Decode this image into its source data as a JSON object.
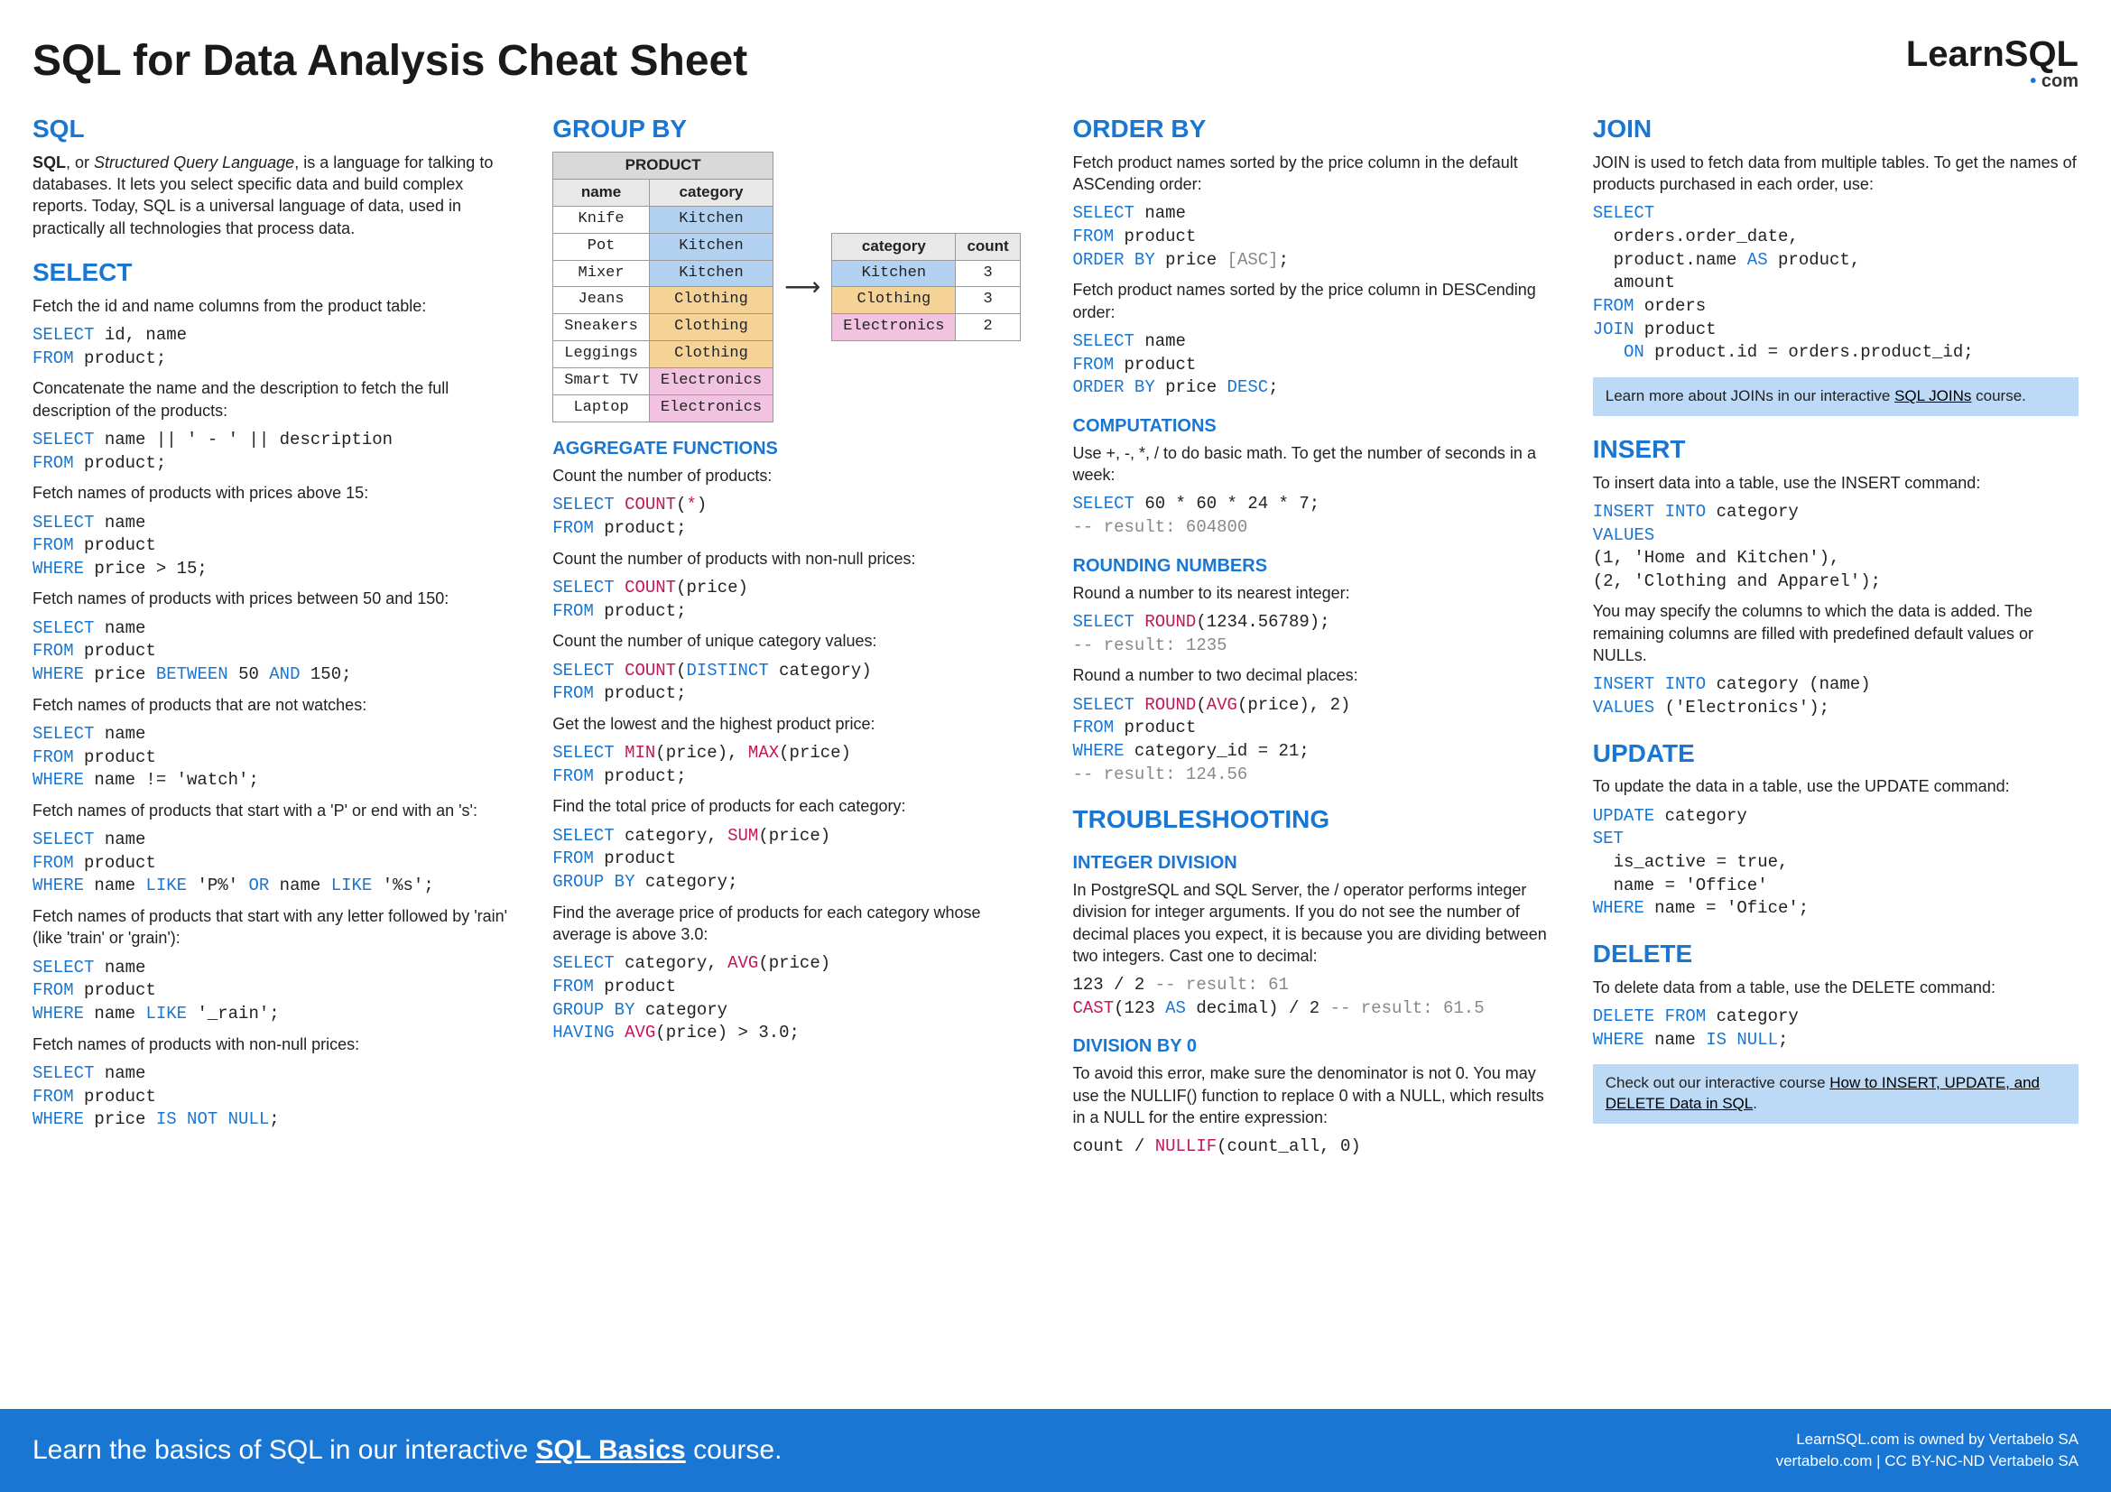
{
  "title": "SQL for Data Analysis Cheat Sheet",
  "logo": {
    "learn": "Learn",
    "sql": "SQL",
    "dot": "•",
    "com": "com"
  },
  "sql": {
    "heading": "SQL",
    "intro_pre": "SQL",
    "intro_mid": ", or ",
    "intro_em": "Structured Query Language",
    "intro_post": ", is a language for talking to databases. It lets you select specific data and build complex reports. Today, SQL is a universal language of data, used in practically all technologies that process data."
  },
  "select": {
    "heading": "SELECT",
    "ex1_desc": "Fetch the id and name columns from the product table:",
    "ex1_l1a": "SELECT",
    "ex1_l1b": " id, name",
    "ex1_l2a": "FROM",
    "ex1_l2b": " product;",
    "ex2_desc": "Concatenate the name and the description to fetch the full description of the products:",
    "ex2_l1a": "SELECT",
    "ex2_l1b": " name || ' - ' || description",
    "ex2_l2a": "FROM",
    "ex2_l2b": " product;",
    "ex3_desc": "Fetch names of products with prices above 15:",
    "ex3_l1a": "SELECT",
    "ex3_l1b": " name",
    "ex3_l2a": "FROM",
    "ex3_l2b": " product",
    "ex3_l3a": "WHERE",
    "ex3_l3b": " price > 15;",
    "ex4_desc": "Fetch names of products with prices between 50 and 150:",
    "ex4_l1a": "SELECT",
    "ex4_l1b": " name",
    "ex4_l2a": "FROM",
    "ex4_l2b": " product",
    "ex4_l3a": "WHERE",
    "ex4_l3b": " price ",
    "ex4_l3c": "BETWEEN",
    "ex4_l3d": " 50 ",
    "ex4_l3e": "AND",
    "ex4_l3f": " 150;",
    "ex5_desc": "Fetch names of products that are not watches:",
    "ex5_l1a": "SELECT",
    "ex5_l1b": " name",
    "ex5_l2a": "FROM",
    "ex5_l2b": " product",
    "ex5_l3a": "WHERE",
    "ex5_l3b": " name != 'watch';",
    "ex6_desc": "Fetch names of products that start with a 'P' or end with an 's':",
    "ex6_l1a": "SELECT",
    "ex6_l1b": " name",
    "ex6_l2a": "FROM",
    "ex6_l2b": " product",
    "ex6_l3a": "WHERE",
    "ex6_l3b": " name ",
    "ex6_l3c": "LIKE",
    "ex6_l3d": " 'P%' ",
    "ex6_l3e": "OR",
    "ex6_l3f": " name ",
    "ex6_l3g": "LIKE",
    "ex6_l3h": " '%s';",
    "ex7_desc": "Fetch names of products that start with any letter followed by 'rain' (like 'train' or 'grain'):",
    "ex7_l1a": "SELECT",
    "ex7_l1b": " name",
    "ex7_l2a": "FROM",
    "ex7_l2b": " product",
    "ex7_l3a": "WHERE",
    "ex7_l3b": " name ",
    "ex7_l3c": "LIKE",
    "ex7_l3d": " '_rain';",
    "ex8_desc": "Fetch names of products with non-null prices:",
    "ex8_l1a": "SELECT",
    "ex8_l1b": " name",
    "ex8_l2a": "FROM",
    "ex8_l2b": " product",
    "ex8_l3a": "WHERE",
    "ex8_l3b": " price ",
    "ex8_l3c": "IS NOT NULL",
    "ex8_l3d": ";"
  },
  "groupby": {
    "heading": "GROUP BY",
    "table_title": "PRODUCT",
    "h_name": "name",
    "h_category": "category",
    "h_count": "count",
    "rows": [
      {
        "name": "Knife",
        "cat": "Kitchen",
        "cls": "cat-kitchen"
      },
      {
        "name": "Pot",
        "cat": "Kitchen",
        "cls": "cat-kitchen"
      },
      {
        "name": "Mixer",
        "cat": "Kitchen",
        "cls": "cat-kitchen"
      },
      {
        "name": "Jeans",
        "cat": "Clothing",
        "cls": "cat-clothing"
      },
      {
        "name": "Sneakers",
        "cat": "Clothing",
        "cls": "cat-clothing"
      },
      {
        "name": "Leggings",
        "cat": "Clothing",
        "cls": "cat-clothing"
      },
      {
        "name": "Smart TV",
        "cat": "Electronics",
        "cls": "cat-electronics"
      },
      {
        "name": "Laptop",
        "cat": "Electronics",
        "cls": "cat-electronics"
      }
    ],
    "agg": [
      {
        "cat": "Kitchen",
        "count": "3",
        "cls": "cat-kitchen"
      },
      {
        "cat": "Clothing",
        "count": "3",
        "cls": "cat-clothing"
      },
      {
        "cat": "Electronics",
        "count": "2",
        "cls": "cat-electronics"
      }
    ],
    "arrow": "⟶"
  },
  "aggfn": {
    "heading": "AGGREGATE FUNCTIONS",
    "e1_desc": "Count the number of products:",
    "e1_l1a": "SELECT ",
    "e1_l1b": "COUNT",
    "e1_l1c": "(",
    "e1_l1d": "*",
    "e1_l1e": ")",
    "e1_l2a": "FROM",
    "e1_l2b": " product;",
    "e2_desc": "Count the number of products with non-null prices:",
    "e2_l1a": "SELECT ",
    "e2_l1b": "COUNT",
    "e2_l1c": "(price)",
    "e2_l2a": "FROM",
    "e2_l2b": " product;",
    "e3_desc": "Count the number of unique category values:",
    "e3_l1a": "SELECT ",
    "e3_l1b": "COUNT",
    "e3_l1c": "(",
    "e3_l1d": "DISTINCT",
    "e3_l1e": " category)",
    "e3_l2a": "FROM",
    "e3_l2b": " product;",
    "e4_desc": "Get the lowest and the highest product price:",
    "e4_l1a": "SELECT ",
    "e4_l1b": "MIN",
    "e4_l1c": "(price), ",
    "e4_l1d": "MAX",
    "e4_l1e": "(price)",
    "e4_l2a": "FROM",
    "e4_l2b": " product;",
    "e5_desc": "Find the total price of products for each category:",
    "e5_l1a": "SELECT",
    "e5_l1b": " category, ",
    "e5_l1c": "SUM",
    "e5_l1d": "(price)",
    "e5_l2a": "FROM",
    "e5_l2b": " product",
    "e5_l3a": "GROUP BY",
    "e5_l3b": " category;",
    "e6_desc": "Find the average price of products for each category whose average is above 3.0:",
    "e6_l1a": "SELECT",
    "e6_l1b": " category, ",
    "e6_l1c": "AVG",
    "e6_l1d": "(price)",
    "e6_l2a": "FROM",
    "e6_l2b": " product",
    "e6_l3a": "GROUP BY",
    "e6_l3b": " category",
    "e6_l4a": "HAVING ",
    "e6_l4b": "AVG",
    "e6_l4c": "(price) > 3.0;"
  },
  "orderby": {
    "heading": "ORDER BY",
    "e1_desc": "Fetch product names sorted by the price column in the default ASCending order:",
    "e1_l1a": "SELECT",
    "e1_l1b": " name",
    "e1_l2a": "FROM",
    "e1_l2b": " product",
    "e1_l3a": "ORDER BY",
    "e1_l3b": " price ",
    "e1_l3c": "[ASC]",
    "e1_l3d": ";",
    "e2_desc": "Fetch product names sorted by the price column in DESCending order:",
    "e2_l1a": "SELECT",
    "e2_l1b": " name",
    "e2_l2a": "FROM",
    "e2_l2b": " product",
    "e2_l3a": "ORDER BY",
    "e2_l3b": " price ",
    "e2_l3c": "DESC",
    "e2_l3d": ";"
  },
  "comp": {
    "heading": "COMPUTATIONS",
    "desc": "Use +, -, *, / to do basic math. To get the number of seconds in a week:",
    "l1a": "SELECT",
    "l1b": " 60 * 60 * 24 * 7;",
    "l2": "-- result: 604800"
  },
  "round": {
    "heading": "ROUNDING NUMBERS",
    "e1_desc": "Round a number to its nearest integer:",
    "e1_l1a": "SELECT ",
    "e1_l1b": "ROUND",
    "e1_l1c": "(1234.56789);",
    "e1_l2": "-- result: 1235",
    "e2_desc": "Round a number to two decimal places:",
    "e2_l1a": "SELECT ",
    "e2_l1b": "ROUND",
    "e2_l1c": "(",
    "e2_l1d": "AVG",
    "e2_l1e": "(price), 2)",
    "e2_l2a": "FROM",
    "e2_l2b": " product",
    "e2_l3a": "WHERE",
    "e2_l3b": " category_id = 21;",
    "e2_l4": "-- result: 124.56"
  },
  "trouble": {
    "heading": "TROUBLESHOOTING",
    "int_heading": "INTEGER DIVISION",
    "int_desc": "In PostgreSQL and SQL Server, the / operator performs integer division for integer arguments. If you do not see the number of decimal places you expect, it is because you are dividing between two integers. Cast one to decimal:",
    "int_l1a": "123 / 2 ",
    "int_l1b": "-- result: 61",
    "int_l2a": "CAST",
    "int_l2b": "(123 ",
    "int_l2c": "AS",
    "int_l2d": " decimal) / 2 ",
    "int_l2e": "-- result: 61.5",
    "div0_heading": "DIVISION BY 0",
    "div0_desc": "To avoid this error, make sure the denominator is not 0. You may use the NULLIF() function to replace 0 with a NULL, which results in a NULL for the entire expression:",
    "div0_l1a": "count / ",
    "div0_l1b": "NULLIF",
    "div0_l1c": "(count_all, 0)"
  },
  "join": {
    "heading": "JOIN",
    "desc": "JOIN is used to fetch data from multiple tables. To get the names of products purchased in each order, use:",
    "l1": "SELECT",
    "l2": "  orders.order_date,",
    "l3a": "  product.name ",
    "l3b": "AS",
    "l3c": " product,",
    "l4": "  amount",
    "l5a": "FROM",
    "l5b": " orders",
    "l6a": "JOIN",
    "l6b": " product",
    "l7a": "   ON",
    "l7b": " product.id = orders.product_id;",
    "callout_pre": "Learn more about JOINs in our interactive ",
    "callout_link": "SQL JOINs",
    "callout_post": " course."
  },
  "insert": {
    "heading": "INSERT",
    "e1_desc": "To insert data into a table, use the INSERT command:",
    "e1_l1a": "INSERT INTO",
    "e1_l1b": " category",
    "e1_l2": "VALUES",
    "e1_l3": "(1, 'Home and Kitchen'),",
    "e1_l4": "(2, 'Clothing and Apparel');",
    "e2_desc": "You may specify the columns to which the data is added. The remaining columns are filled with predefined default values or NULLs.",
    "e2_l1a": "INSERT INTO",
    "e2_l1b": " category (name)",
    "e2_l2a": "VALUES",
    "e2_l2b": " ('Electronics');"
  },
  "update": {
    "heading": "UPDATE",
    "desc": "To update the data in a table, use the UPDATE command:",
    "l1a": "UPDATE",
    "l1b": " category",
    "l2": "SET",
    "l3": "  is_active = true,",
    "l4": "  name = 'Office'",
    "l5a": "WHERE",
    "l5b": " name = 'Ofice';"
  },
  "delete": {
    "heading": "DELETE",
    "desc": "To delete data from a table, use the DELETE command:",
    "l1a": "DELETE FROM",
    "l1b": " category",
    "l2a": "WHERE",
    "l2b": " name ",
    "l2c": "IS NULL",
    "l2d": ";",
    "callout_pre": "Check out our interactive course ",
    "callout_link": "How to INSERT, UPDATE, and DELETE Data in SQL",
    "callout_post": "."
  },
  "footer": {
    "left_pre": "Learn the basics of SQL in our interactive ",
    "left_link": "SQL Basics",
    "left_post": " course.",
    "r1": "LearnSQL.com is owned by Vertabelo SA",
    "r2": "vertabelo.com | CC BY-NC-ND Vertabelo SA"
  }
}
